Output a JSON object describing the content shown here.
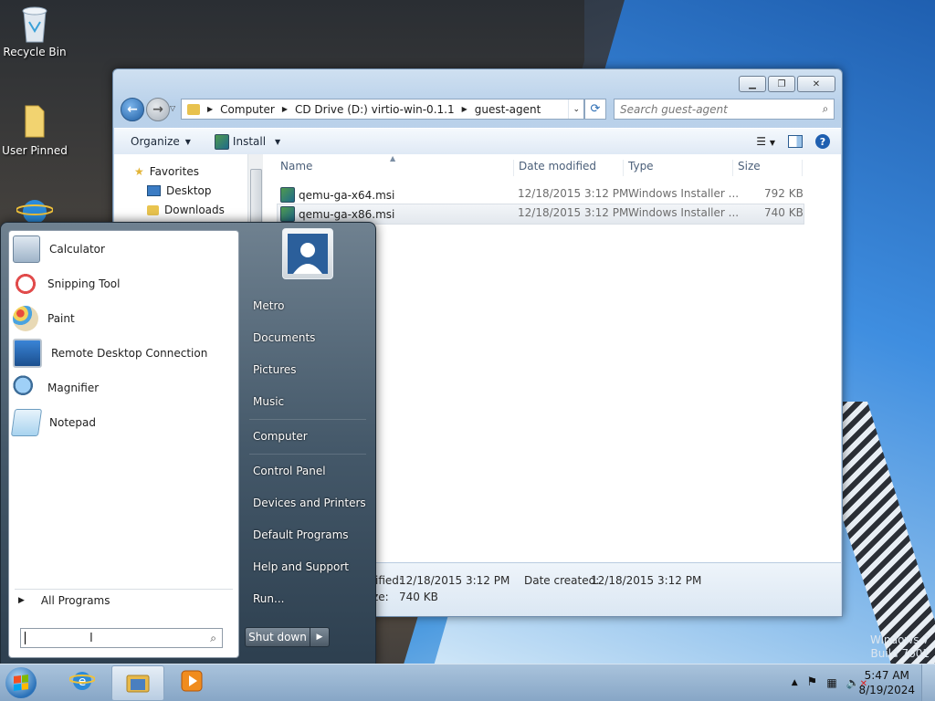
{
  "desktop": {
    "icons": [
      {
        "label": "Recycle Bin",
        "icon": "recycle-bin-icon"
      },
      {
        "label": "User Pinned",
        "icon": "folder-icon"
      },
      {
        "label": "",
        "icon": "internet-explorer-icon"
      }
    ],
    "watermark": {
      "line1": "Windows 7",
      "line2": "Build 7601"
    }
  },
  "explorer": {
    "breadcrumb": [
      "Computer",
      "CD Drive (D:) virtio-win-0.1.1",
      "guest-agent"
    ],
    "search_placeholder": "Search guest-agent",
    "toolbar": {
      "organize": "Organize",
      "install": "Install"
    },
    "nav": [
      {
        "label": "Favorites",
        "icon": "star-icon"
      },
      {
        "label": "Desktop",
        "icon": "desktop-icon"
      },
      {
        "label": "Downloads",
        "icon": "downloads-folder-icon"
      }
    ],
    "columns": {
      "name": "Name",
      "date": "Date modified",
      "type": "Type",
      "size": "Size"
    },
    "files": [
      {
        "name": "qemu-ga-x64.msi",
        "date": "12/18/2015 3:12 PM",
        "type": "Windows Installer ...",
        "size": "792 KB"
      },
      {
        "name": "qemu-ga-x86.msi",
        "date": "12/18/2015 3:12 PM",
        "type": "Windows Installer ...",
        "size": "740 KB"
      }
    ],
    "details": {
      "modified_label": "ified:",
      "modified_value": "12/18/2015 3:12 PM",
      "created_label": "Date created:",
      "created_value": "12/18/2015 3:12 PM",
      "size_label": "Size:",
      "size_value": "740 KB"
    }
  },
  "start_menu": {
    "programs": [
      {
        "label": "Calculator",
        "icon": "calculator-icon"
      },
      {
        "label": "Snipping Tool",
        "icon": "scissors-icon"
      },
      {
        "label": "Paint",
        "icon": "paint-palette-icon"
      },
      {
        "label": "Remote Desktop Connection",
        "icon": "remote-desktop-icon"
      },
      {
        "label": "Magnifier",
        "icon": "magnifier-icon"
      },
      {
        "label": "Notepad",
        "icon": "notepad-icon"
      }
    ],
    "all_programs": "All Programs",
    "search_value": "",
    "right_links": [
      "Metro",
      "Documents",
      "Pictures",
      "Music",
      "Computer",
      "Control Panel",
      "Devices and Printers",
      "Default Programs",
      "Help and Support",
      "Run..."
    ],
    "shutdown": "Shut down"
  },
  "taskbar": {
    "pinned": [
      "internet-explorer-icon",
      "explorer-folder-icon",
      "media-player-icon"
    ],
    "clock_time": "5:47 AM",
    "clock_date": "8/19/2024"
  }
}
